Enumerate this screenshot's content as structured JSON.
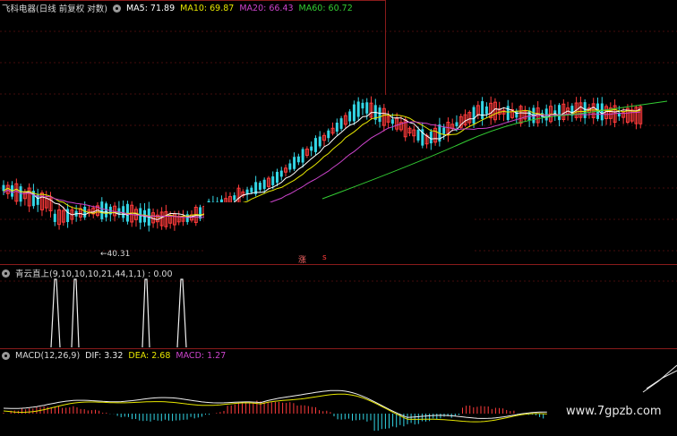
{
  "price_pane": {
    "stock_title": "飞科电器(日线 前复权 对数)",
    "ma": [
      {
        "label": "MA5: 71.89",
        "color": "#ffffff"
      },
      {
        "label": "MA10: 69.87",
        "color": "#e6e600"
      },
      {
        "label": "MA20: 66.43",
        "color": "#cc44cc"
      },
      {
        "label": "MA60: 60.72",
        "color": "#33cc33"
      }
    ],
    "low_marker": "←40.31",
    "rise_text": "涨",
    "rise_sub": "s"
  },
  "indicator_pane": {
    "title": "青云直上(9,10,10,10,21,44,1,1) : 0.00"
  },
  "macd_pane": {
    "name": "MACD(12,26,9)",
    "dif": "DIF: 3.32",
    "dea": "DEA: 2.68",
    "macd": "MACD: 1.27"
  },
  "watermark": "www.7gpzb.com",
  "colors": {
    "up": "#ff3b3b",
    "down": "#33d6e6",
    "grid": "#8a1b1b",
    "ma5": "#ffffff",
    "ma10": "#e6e600",
    "ma20": "#cc44cc",
    "ma60": "#33cc33"
  }
}
